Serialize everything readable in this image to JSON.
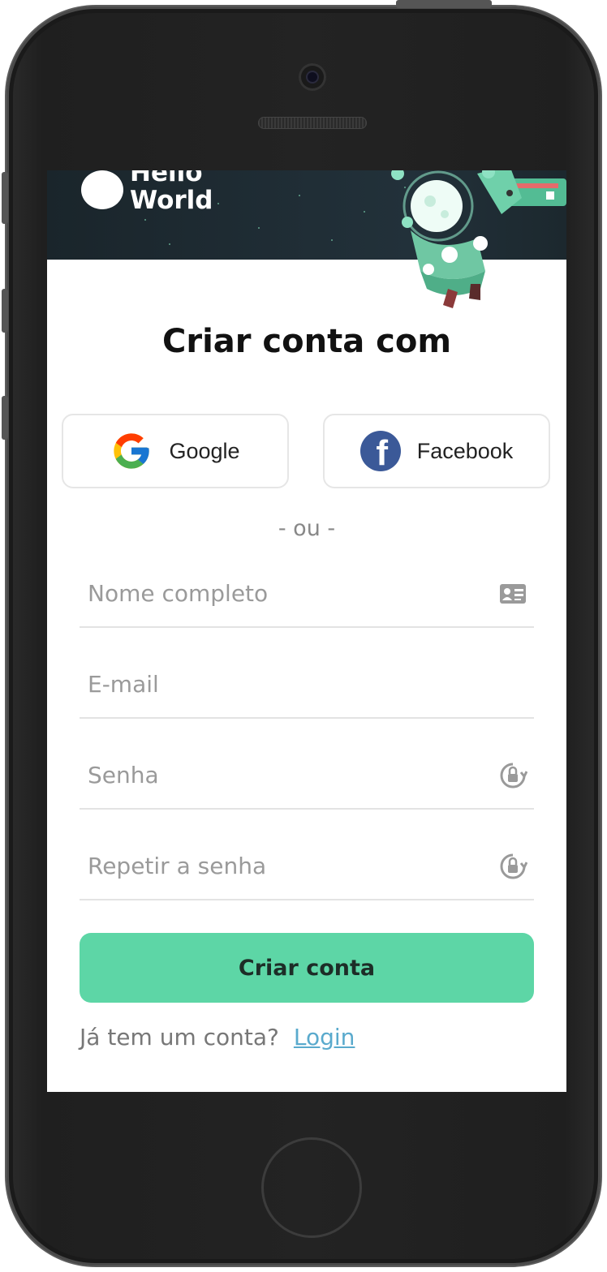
{
  "banner": {
    "logo_line1": "Hello",
    "logo_line2": "World"
  },
  "title": "Criar conta com",
  "social": {
    "google_label": "Google",
    "facebook_label": "Facebook"
  },
  "divider": "- ou -",
  "form": {
    "name_placeholder": "Nome completo",
    "email_placeholder": "E-mail",
    "password_placeholder": "Senha",
    "repeat_placeholder": "Repetir a senha",
    "submit_label": "Criar conta"
  },
  "footer": {
    "question": "Já tem um conta?",
    "login_link": "Login"
  },
  "colors": {
    "accent": "#5dd6a6",
    "link": "#5aaacd",
    "banner_bg": "#1f2d34",
    "facebook": "#3b5998"
  },
  "icons": [
    "google-icon",
    "facebook-icon",
    "id-card-icon",
    "lock-icon"
  ]
}
